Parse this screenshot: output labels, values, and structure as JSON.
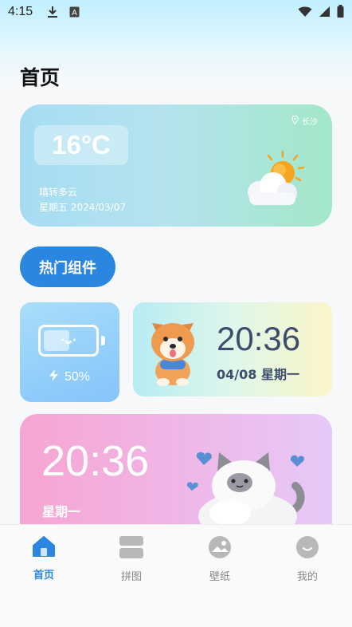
{
  "status_bar": {
    "time": "4:15",
    "icons": [
      "download-icon",
      "keyboard-a-icon",
      "wifi-icon",
      "signal-icon",
      "battery-icon"
    ]
  },
  "page": {
    "title": "首页"
  },
  "weather": {
    "temperature": "16°C",
    "condition": "晴转多云",
    "date": "星期五 2024/03/07",
    "location": "长沙",
    "icon": "sun-cloud-icon"
  },
  "hot_widgets": {
    "label": "热门组件"
  },
  "battery_widget": {
    "level_text": "50%",
    "level": 0.5,
    "face": "·ᴗ·",
    "icon": "lightning-icon"
  },
  "clock_widget": {
    "time": "20:36",
    "date": "04/08  星期一",
    "mascot": "shiba-dog"
  },
  "pink_widget": {
    "time": "20:36",
    "weekday": "星期一",
    "mascot": "cat"
  },
  "bottom_nav": {
    "items": [
      {
        "label": "首页",
        "icon": "home-icon",
        "active": true
      },
      {
        "label": "拼图",
        "icon": "puzzle-icon",
        "active": false
      },
      {
        "label": "壁纸",
        "icon": "wallpaper-icon",
        "active": false
      },
      {
        "label": "我的",
        "icon": "profile-icon",
        "active": false
      }
    ]
  },
  "colors": {
    "accent": "#2b86e0",
    "text_dark": "#3d4d6e"
  }
}
